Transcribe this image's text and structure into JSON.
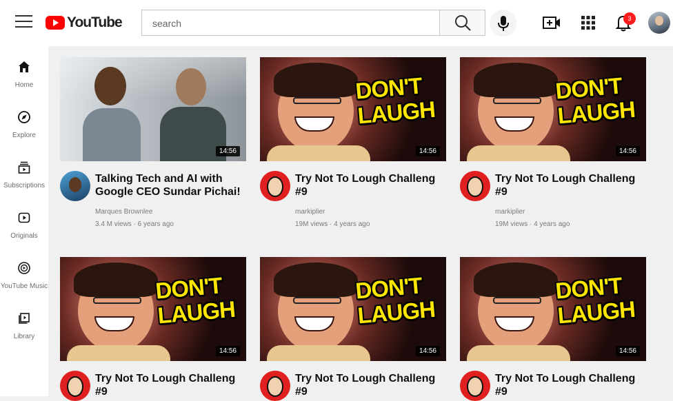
{
  "header": {
    "logo_text": "YouTube",
    "search_placeholder": "search",
    "notifications_count": "3"
  },
  "sidebar": {
    "items": [
      {
        "label": "Home",
        "icon": "home-icon"
      },
      {
        "label": "Explore",
        "icon": "compass-icon"
      },
      {
        "label": "Subscriptions",
        "icon": "subscriptions-icon"
      },
      {
        "label": "Originals",
        "icon": "originals-icon"
      },
      {
        "label": "YouTube Music",
        "icon": "music-icon"
      },
      {
        "label": "Library",
        "icon": "library-icon"
      }
    ]
  },
  "videos": [
    {
      "title": "Talking Tech and AI with Google CEO Sundar Pichai!",
      "channel": "Marques Brownlee",
      "meta": "3.4 M views · 6 years ago",
      "duration": "14:56",
      "thumb_text": ""
    },
    {
      "title": "Try Not To Lough Challeng #9",
      "channel": "markiplier",
      "meta": "19M views · 4 years ago",
      "duration": "14:56",
      "thumb_text": "DON'T LAUGH"
    },
    {
      "title": "Try Not To Lough Challeng #9",
      "channel": "markiplier",
      "meta": "19M views · 4 years ago",
      "duration": "14:56",
      "thumb_text": "DON'T LAUGH"
    },
    {
      "title": "Try Not To Lough Challeng #9",
      "channel": "",
      "meta": "",
      "duration": "14:56",
      "thumb_text": "DON'T LAUGH"
    },
    {
      "title": "Try Not To Lough Challeng #9",
      "channel": "",
      "meta": "",
      "duration": "14:56",
      "thumb_text": "DON'T LAUGH"
    },
    {
      "title": "Try Not To Lough Challeng #9",
      "channel": "",
      "meta": "",
      "duration": "14:56",
      "thumb_text": "DON'T LAUGH"
    }
  ],
  "colors": {
    "brand_red": "#ff0000",
    "badge_red": "#ff1c1c",
    "thumb_text_yellow": "#ffe600"
  }
}
